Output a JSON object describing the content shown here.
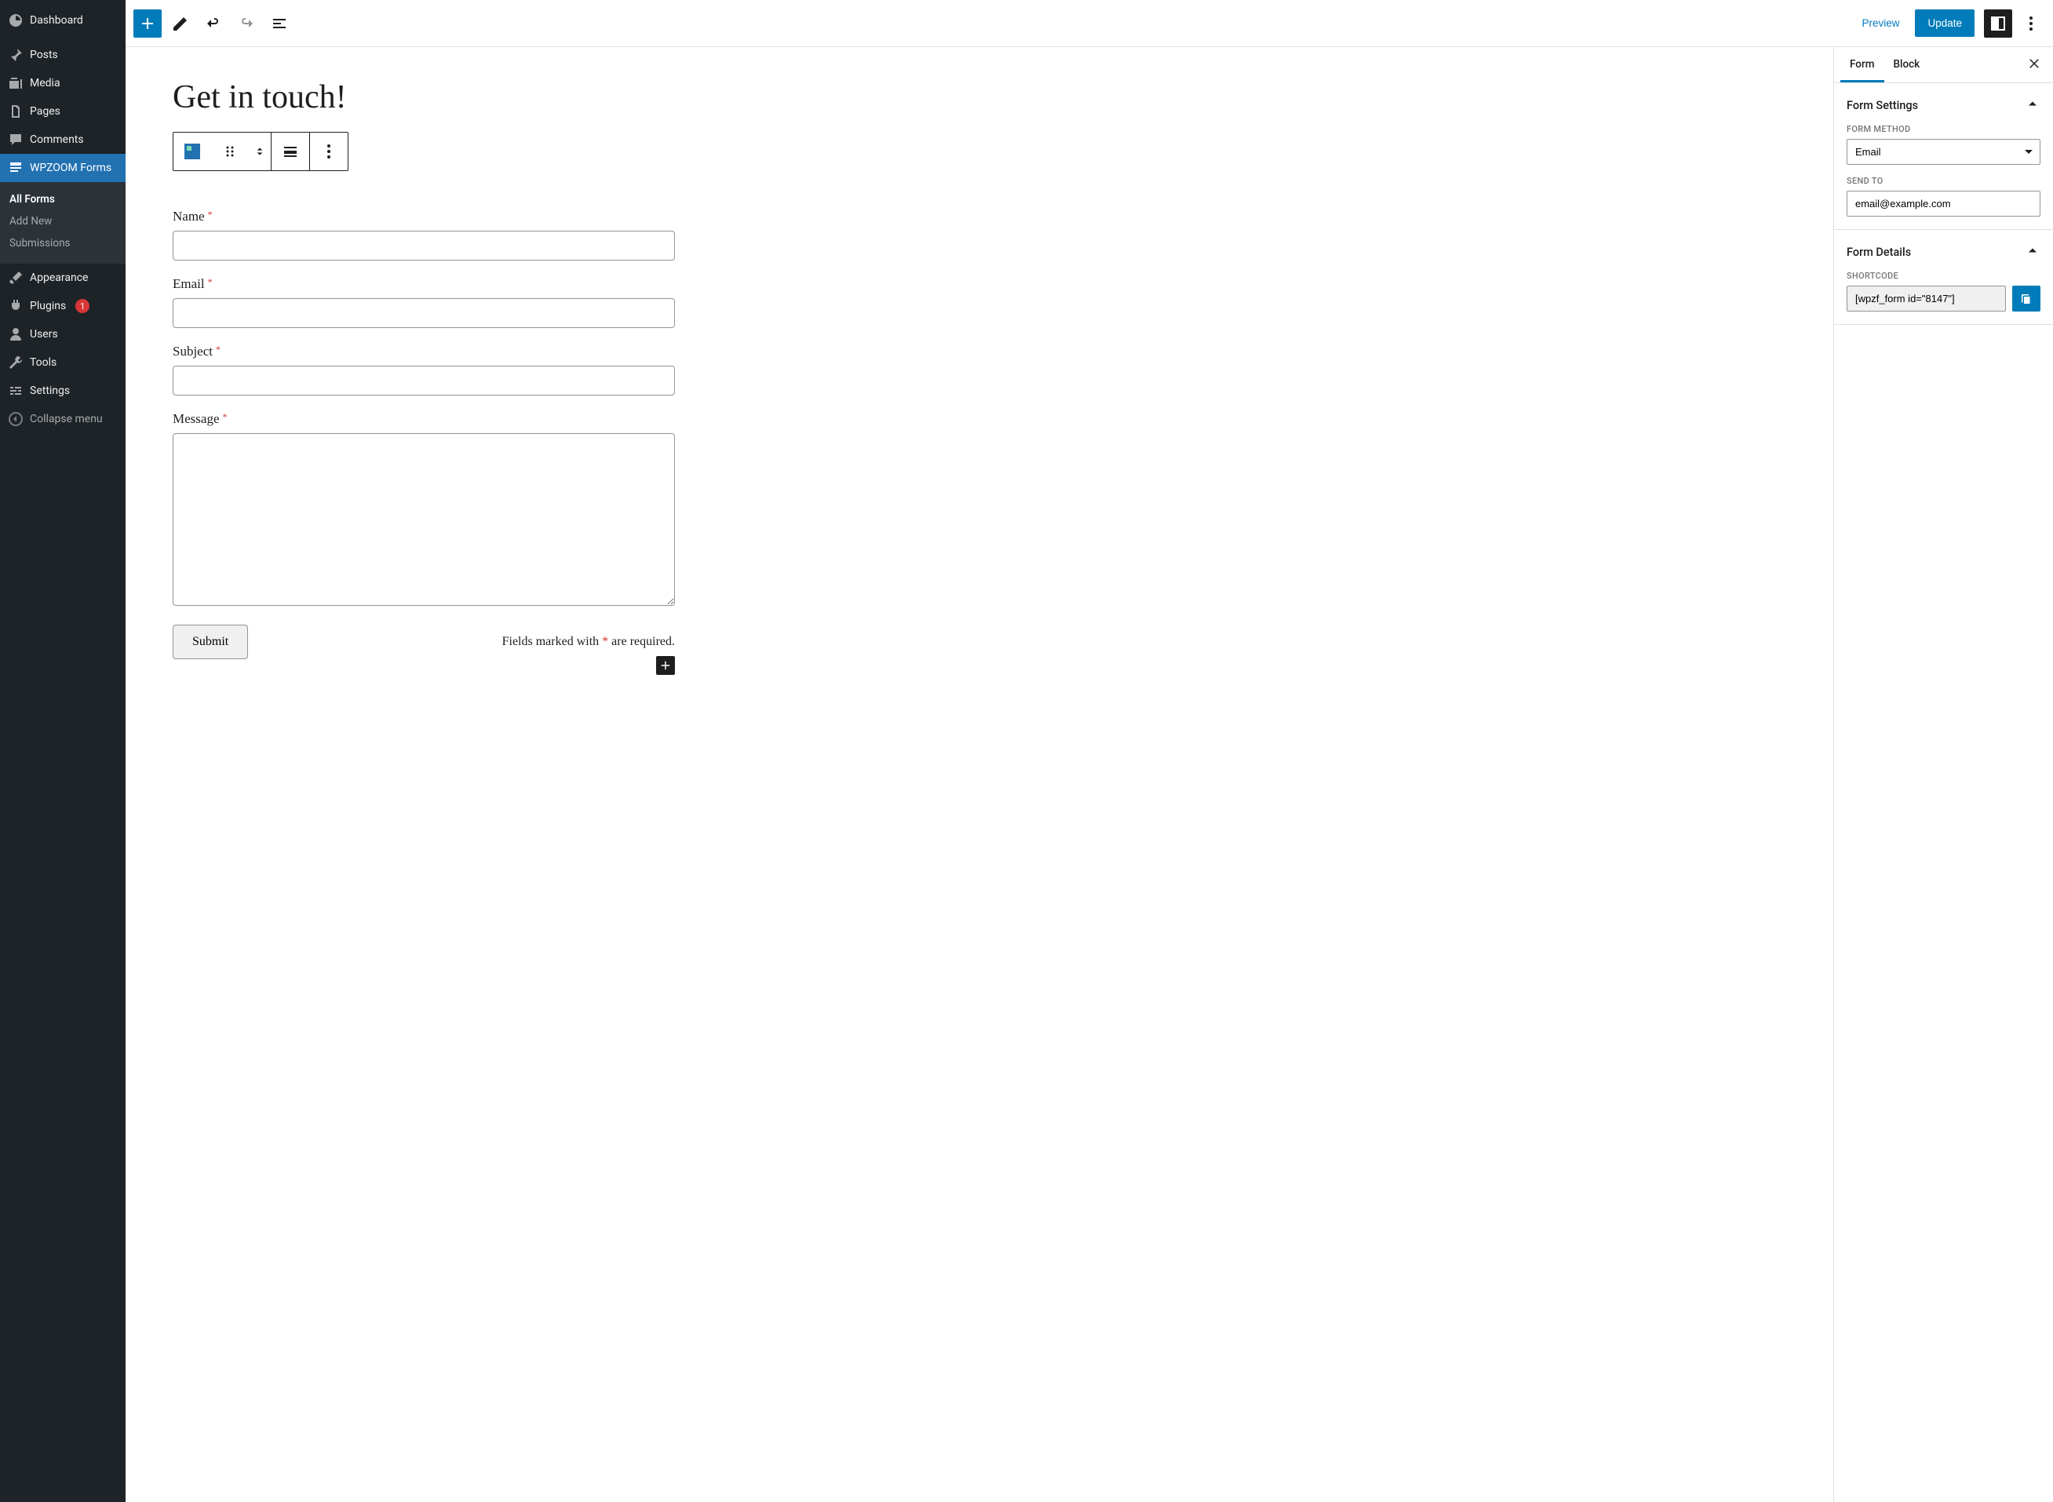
{
  "sidebar": {
    "dashboard": "Dashboard",
    "items": [
      {
        "label": "Posts",
        "icon": "pin-icon"
      },
      {
        "label": "Media",
        "icon": "media-icon"
      },
      {
        "label": "Pages",
        "icon": "pages-icon"
      },
      {
        "label": "Comments",
        "icon": "comment-icon"
      }
    ],
    "current": {
      "label": "WPZOOM Forms",
      "icon": "form-icon"
    },
    "submenu": [
      {
        "label": "All Forms",
        "active": true
      },
      {
        "label": "Add New"
      },
      {
        "label": "Submissions"
      }
    ],
    "items2": [
      {
        "label": "Appearance",
        "icon": "brush-icon"
      },
      {
        "label": "Plugins",
        "icon": "plug-icon",
        "badge": "1"
      },
      {
        "label": "Users",
        "icon": "user-icon"
      },
      {
        "label": "Tools",
        "icon": "wrench-icon"
      },
      {
        "label": "Settings",
        "icon": "settings-icon"
      }
    ],
    "collapse": "Collapse menu"
  },
  "topbar": {
    "preview": "Preview",
    "update": "Update"
  },
  "editor": {
    "title": "Get in touch!",
    "fields": {
      "name": "Name",
      "email": "Email",
      "subject": "Subject",
      "message": "Message"
    },
    "submit": "Submit",
    "required_note_pre": "Fields marked with ",
    "required_note_post": " are required.",
    "required_mark": "*"
  },
  "settings": {
    "tabs": {
      "form": "Form",
      "block": "Block"
    },
    "form_settings": {
      "title": "Form Settings",
      "method_label": "FORM METHOD",
      "method_value": "Email",
      "send_to_label": "SEND TO",
      "send_to_value": "email@example.com"
    },
    "form_details": {
      "title": "Form Details",
      "shortcode_label": "SHORTCODE",
      "shortcode_value": "[wpzf_form id=\"8147\"]"
    }
  }
}
